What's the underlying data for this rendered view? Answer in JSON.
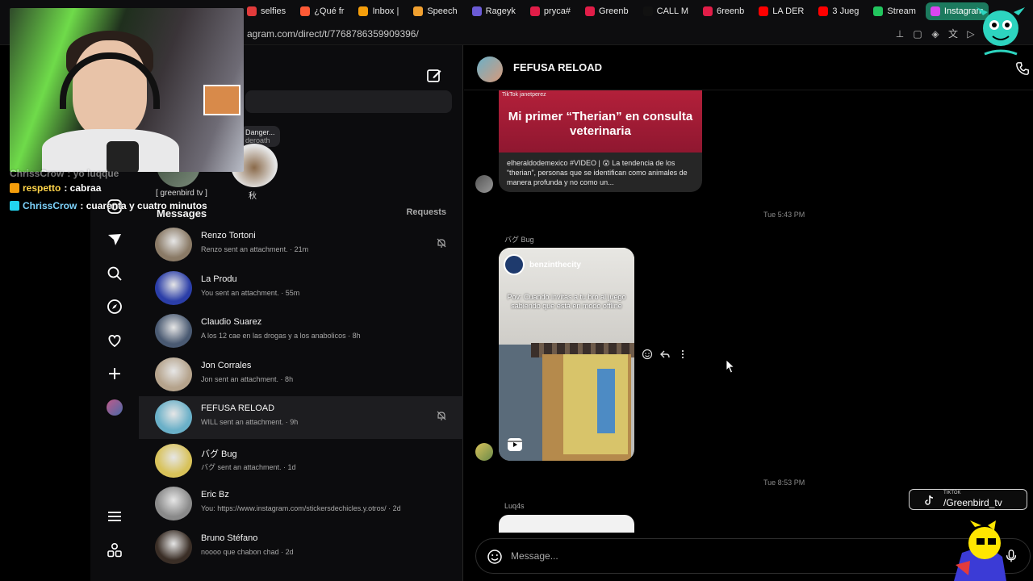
{
  "browser": {
    "tabs": [
      {
        "label": "selfies",
        "color": "#e23b3b"
      },
      {
        "label": "¿Qué fr",
        "color": "#ff5a36"
      },
      {
        "label": "Inbox |",
        "color": "#f59e0b"
      },
      {
        "label": "Speech",
        "color": "#f0a030"
      },
      {
        "label": "Rageyk",
        "color": "#6b5bd6"
      },
      {
        "label": "pryca#",
        "color": "#e11d48"
      },
      {
        "label": "Greenb",
        "color": "#e11d48"
      },
      {
        "label": "CALL M",
        "color": "#111111"
      },
      {
        "label": "6reenb",
        "color": "#e11d48"
      },
      {
        "label": "LA DER",
        "color": "#ff0000"
      },
      {
        "label": "3 Jueg",
        "color": "#ff0000"
      },
      {
        "label": "Stream",
        "color": "#22c55e"
      },
      {
        "label": "Instagram",
        "color": "#d946ef",
        "active": true
      }
    ],
    "url": "agram.com/direct/t/7768786359909396/"
  },
  "stream_chat": [
    {
      "user": "ChrissCrow",
      "text": ": yo luqque",
      "partial": true
    },
    {
      "user": "respetto",
      "text": ": cabraa",
      "badge_color": "#f59e0b",
      "user_color": "#ffd54a"
    },
    {
      "user": "ChrissCrow",
      "text": ": cuarenta y cuatro minutos",
      "badge_color": "#22d3ee",
      "user_color": "#7dd3fc"
    }
  ],
  "inbox": {
    "note": {
      "title": "Danger...",
      "sub": "deroath"
    },
    "stories": [
      {
        "label": "[ greenbird tv ]"
      },
      {
        "label": "秋"
      }
    ],
    "heading": "Messages",
    "requests_label": "Requests",
    "conversations": [
      {
        "name": "Renzo Tortoni",
        "preview": "Renzo sent an attachment. · 21m",
        "muted": true,
        "avatar_color": "#8a7a66"
      },
      {
        "name": "La Produ",
        "preview": "You sent an attachment. · 55m",
        "muted": false,
        "avatar_color": "#2b3ea8"
      },
      {
        "name": "Claudio Suarez",
        "preview": "A los 12 cae en las drogas y a los anabolicos · 8h",
        "muted": false,
        "avatar_color": "#4a5a72"
      },
      {
        "name": "Jon Corrales",
        "preview": "Jon sent an attachment. · 8h",
        "muted": false,
        "avatar_color": "#b5a38c"
      },
      {
        "name": "FEFUSA RELOAD",
        "preview": "WILL sent an attachment. · 9h",
        "muted": true,
        "selected": true,
        "avatar_color": "#6ab0c8"
      },
      {
        "name": "バグ Bug",
        "preview": "バグ sent an attachment. · 1d",
        "muted": false,
        "avatar_color": "#d8c25a"
      },
      {
        "name": "Eric Bz",
        "preview": "You: https://www.instagram.com/stickersdechicles.y.otros/ · 2d",
        "muted": false,
        "avatar_color": "#8a8a8a"
      },
      {
        "name": "Bruno Stéfano",
        "preview": "noooo que chabon chad · 2d",
        "muted": false,
        "avatar_color": "#3a2e26"
      }
    ]
  },
  "chat": {
    "title": "FEFUSA RELOAD",
    "shared_post": {
      "tag": "TikTok  janetperez",
      "image_text": "Mi primer “Therian” en consulta veterinaria",
      "caption": "elheraldodemexico #VIDEO | 😮 La tendencia de los “therian”, personas que se identifican como animales de manera profunda y no como un..."
    },
    "timestamp_1": "Tue 5:43 PM",
    "sender_1": "バグ Bug",
    "reel": {
      "handle": "benzinthecity",
      "overlay_text": "Pov: Cuando invitas a tu bro al juego sabiendo que está en modo offline"
    },
    "timestamp_2": "Tue 8:53 PM",
    "sender_2": "Luq4s",
    "composer_placeholder": "Message..."
  },
  "overlay": {
    "tiktok_small": "TIKTOK",
    "tiktok_handle": "/Greenbird_tv"
  },
  "colors": {
    "accent": "#0095f6",
    "selected_row": "#1d1d20",
    "active_tab": "#1c7a5e"
  }
}
